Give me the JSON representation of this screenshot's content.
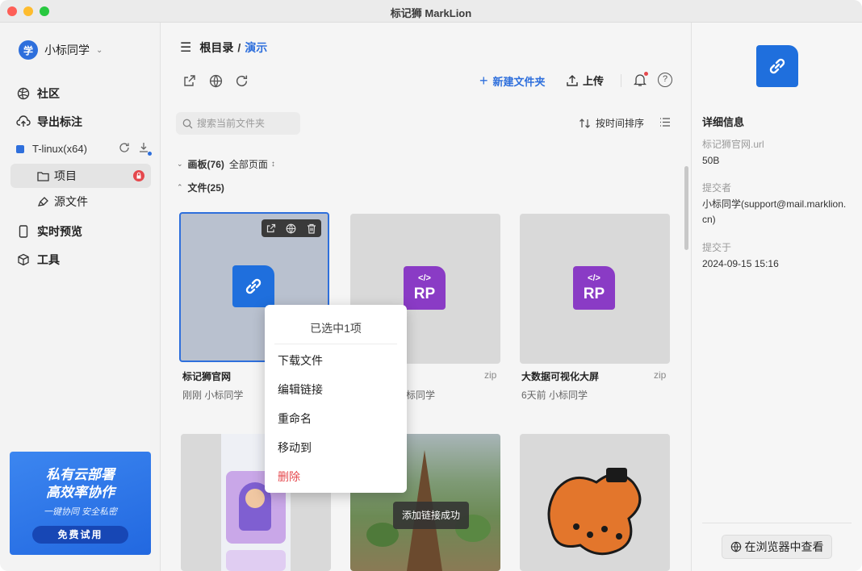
{
  "window": {
    "title": "标记狮 MarkLion"
  },
  "sidebar": {
    "user": {
      "avatar_text": "学",
      "name": "小标同学"
    },
    "nav": [
      {
        "label": "社区",
        "icon": "globe-icon"
      },
      {
        "label": "导出标注",
        "icon": "cloud-upload-icon"
      }
    ],
    "workspace": {
      "name": "T-linux(x64)"
    },
    "sub_items": [
      {
        "label": "项目",
        "icon": "folder-icon"
      },
      {
        "label": "源文件",
        "icon": "pen-icon"
      }
    ],
    "nav2": [
      {
        "label": "实时预览",
        "icon": "phone-icon"
      },
      {
        "label": "工具",
        "icon": "box-icon"
      }
    ],
    "promo": {
      "line1": "私有云部署",
      "line2": "高效率协作",
      "tags": "一键协同  安全私密",
      "button": "免费试用"
    }
  },
  "main": {
    "breadcrumb": {
      "root": "根目录",
      "sep": "/",
      "current": "演示"
    },
    "toolbar": {
      "new_folder": "新建文件夹",
      "upload": "上传"
    },
    "search": {
      "placeholder": "搜索当前文件夹"
    },
    "sort": {
      "label": "按时间排序"
    },
    "boards_section": {
      "label": "画板(76)",
      "filter": "全部页面"
    },
    "files_section": {
      "label": "文件(25)"
    },
    "files": [
      {
        "name": "标记狮官网",
        "meta": "刚刚 小标同学",
        "ext": ""
      },
      {
        "name": "",
        "meta": "标同学",
        "ext": "zip"
      },
      {
        "name": "大数据可视化大屏",
        "meta": "6天前 小标同学",
        "ext": "zip"
      }
    ]
  },
  "context_menu": {
    "header": "已选中1项",
    "items": [
      "下载文件",
      "编辑链接",
      "重命名",
      "移动到",
      "删除"
    ]
  },
  "toast": {
    "text": "添加链接成功"
  },
  "detail": {
    "title": "详细信息",
    "filename": "标记狮官网.url",
    "size": "50B",
    "submitter_label": "提交者",
    "submitter": "小标同学(support@mail.marklion.cn)",
    "submitted_label": "提交于",
    "submitted_at": "2024-09-15 15:16",
    "open_button": "在浏览器中查看"
  },
  "colors": {
    "accent": "#2e6fdc",
    "danger": "#e5484d",
    "rp_purple": "#8a3bc5",
    "link_blue": "#1f6fdd"
  }
}
